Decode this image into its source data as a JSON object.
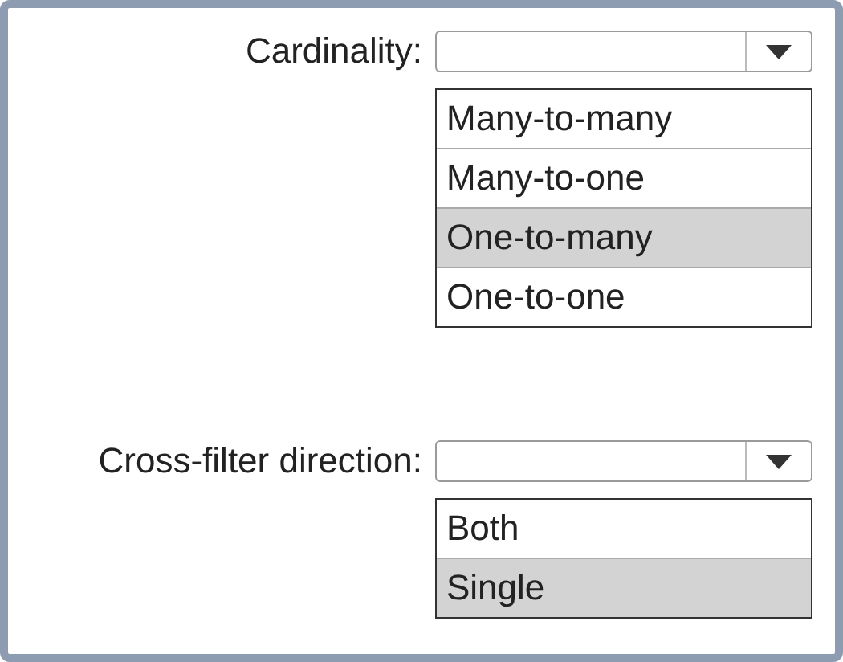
{
  "fields": [
    {
      "label": "Cardinality:",
      "options": [
        {
          "label": "Many-to-many",
          "selected": false
        },
        {
          "label": "Many-to-one",
          "selected": false
        },
        {
          "label": "One-to-many",
          "selected": true
        },
        {
          "label": "One-to-one",
          "selected": false
        }
      ]
    },
    {
      "label": "Cross-filter direction:",
      "options": [
        {
          "label": "Both",
          "selected": false
        },
        {
          "label": "Single",
          "selected": true
        }
      ]
    }
  ]
}
